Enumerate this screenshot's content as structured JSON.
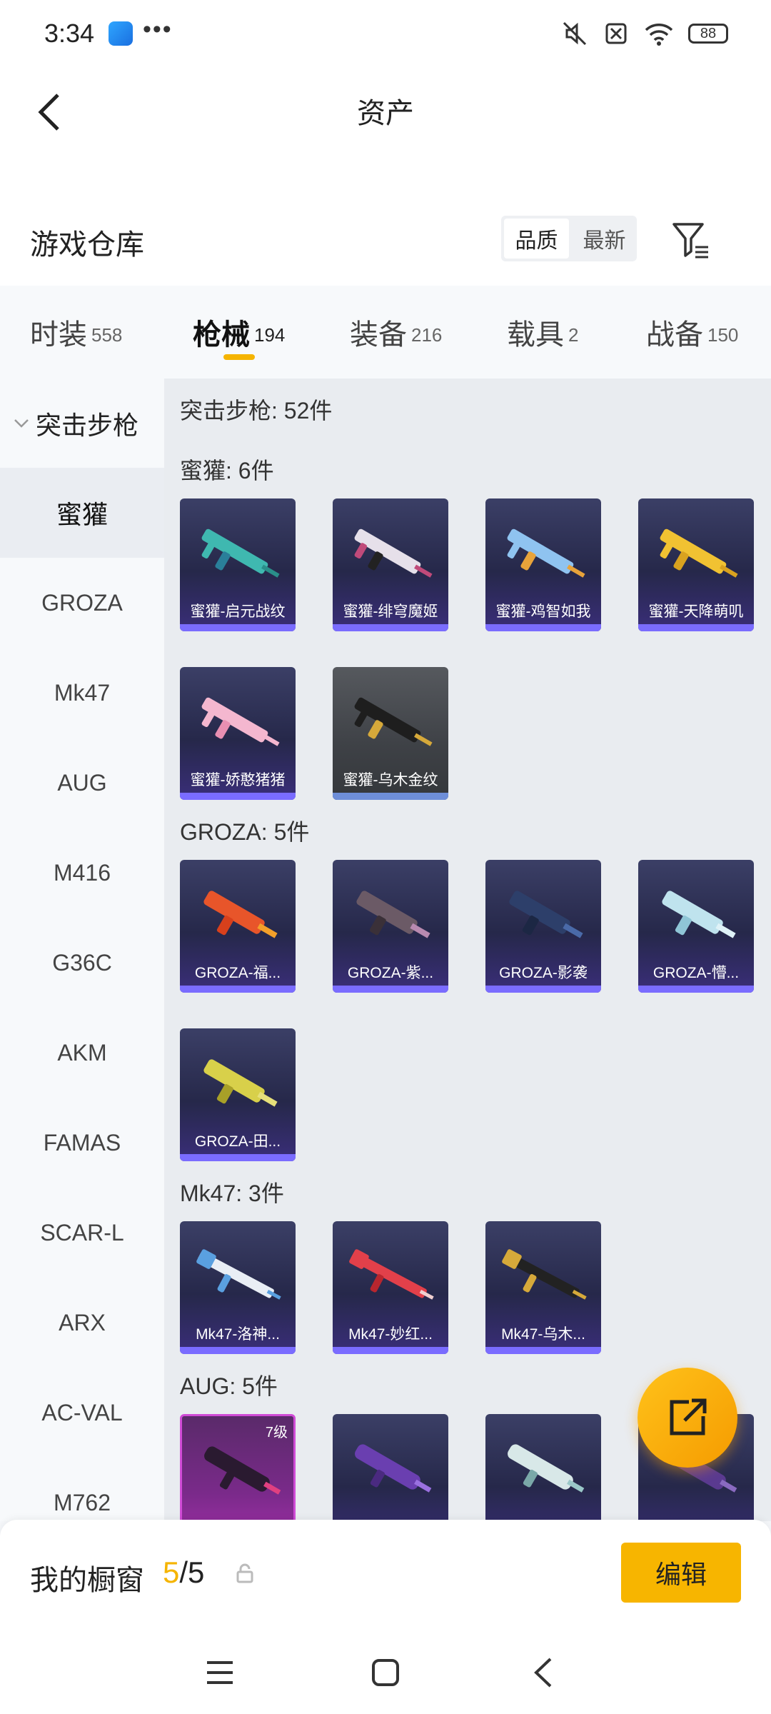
{
  "status_bar": {
    "time": "3:34",
    "dots": "•••",
    "battery": "88"
  },
  "header": {
    "title": "资产"
  },
  "section": {
    "title": "游戏仓库",
    "sort_quality": "品质",
    "sort_latest": "最新"
  },
  "tabs": [
    {
      "label": "时装",
      "count": "558"
    },
    {
      "label": "枪械",
      "count": "194"
    },
    {
      "label": "装备",
      "count": "216"
    },
    {
      "label": "载具",
      "count": "2"
    },
    {
      "label": "战备",
      "count": "150"
    }
  ],
  "sidebar": {
    "group": "突击步枪",
    "items": [
      "蜜獾",
      "GROZA",
      "Mk47",
      "AUG",
      "M416",
      "G36C",
      "AKM",
      "FAMAS",
      "SCAR-L",
      "ARX",
      "AC-VAL",
      "M762"
    ]
  },
  "content": {
    "category_summary": "突击步枪: 52件",
    "groups": [
      {
        "label": "蜜獾: 6件",
        "cards": [
          "蜜獾-启元战纹",
          "蜜獾-绯穹魔姬",
          "蜜獾-鸡智如我",
          "蜜獾-天降萌叽",
          "蜜獾-娇憨猪猪",
          "蜜獾-乌木金纹"
        ]
      },
      {
        "label": "GROZA: 5件",
        "cards": [
          "GROZA-福...",
          "GROZA-紫...",
          "GROZA-影袭",
          "GROZA-懵...",
          "GROZA-田..."
        ]
      },
      {
        "label": "Mk47: 3件",
        "cards": [
          "Mk47-洛神...",
          "Mk47-妙红...",
          "Mk47-乌木..."
        ]
      },
      {
        "label": "AUG: 5件",
        "first_level": "7级"
      }
    ]
  },
  "bottom_bar": {
    "label": "我的橱窗",
    "count_current": "5",
    "count_total": "/5",
    "edit": "编辑"
  },
  "colors": {
    "accent": "#f7b500",
    "card_bg": "#2b2c52",
    "card_bar": "#7a6cff"
  }
}
